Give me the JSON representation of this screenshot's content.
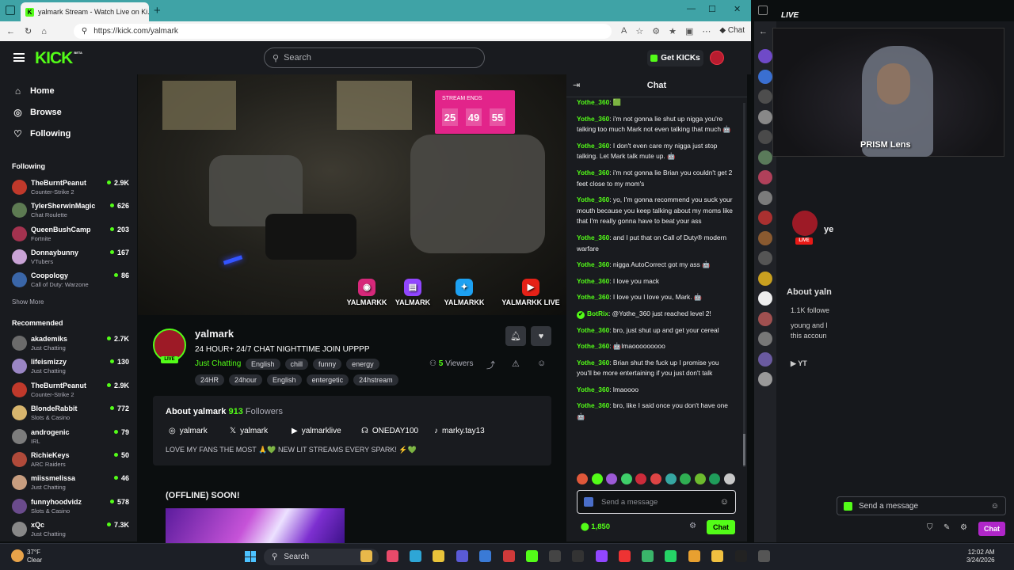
{
  "browser": {
    "tab_title": "yalmark Stream - Watch Live on Ki...",
    "url": "https://kick.com/yalmark",
    "copilot_label": "Chat"
  },
  "header": {
    "logo": "KICK",
    "logo_badge": "BETA",
    "search_placeholder": "Search",
    "get_kicks": "Get KICKs"
  },
  "sidebar": {
    "nav": [
      {
        "label": "Home",
        "icon": "home-icon"
      },
      {
        "label": "Browse",
        "icon": "compass-icon"
      },
      {
        "label": "Following",
        "icon": "heart-icon"
      }
    ],
    "following_title": "Following",
    "following": [
      {
        "name": "TheBurntPeanut",
        "category": "Counter-Strike 2",
        "viewers": "2.9K",
        "color": "#c0392b"
      },
      {
        "name": "TylerSherwinMagic",
        "category": "Chat Roulette",
        "viewers": "626",
        "color": "#5d7a52"
      },
      {
        "name": "QueenBushCamp",
        "category": "Fortnite",
        "viewers": "203",
        "color": "#a3324f"
      },
      {
        "name": "Donnaybunny",
        "category": "VTubers",
        "viewers": "167",
        "color": "#c9a3d6"
      },
      {
        "name": "Coopology",
        "category": "Call of Duty: Warzone",
        "viewers": "86",
        "color": "#3a66a8"
      }
    ],
    "show_more": "Show More",
    "recommended_title": "Recommended",
    "recommended": [
      {
        "name": "akademiks",
        "category": "Just Chatting",
        "viewers": "2.7K",
        "color": "#6b6b6b"
      },
      {
        "name": "lifeismizzy",
        "category": "Just Chatting",
        "viewers": "130",
        "color": "#9a86c4"
      },
      {
        "name": "TheBurntPeanut",
        "category": "Counter-Strike 2",
        "viewers": "2.9K",
        "color": "#c0392b"
      },
      {
        "name": "BlondeRabbit",
        "category": "Slots & Casino",
        "viewers": "772",
        "color": "#d7b56d"
      },
      {
        "name": "androgenic",
        "category": "IRL",
        "viewers": "79",
        "color": "#7c7c7c"
      },
      {
        "name": "RichieKeys",
        "category": "ARC Raiders",
        "viewers": "50",
        "color": "#b04a3a"
      },
      {
        "name": "miissmelissa",
        "category": "Just Chatting",
        "viewers": "46",
        "color": "#c79d7f"
      },
      {
        "name": "funnyhoodvidz",
        "category": "Slots & Casino",
        "viewers": "578",
        "color": "#6a4b8c"
      },
      {
        "name": "xQc",
        "category": "Just Chatting",
        "viewers": "7.3K",
        "color": "#888888"
      }
    ]
  },
  "overlay": {
    "stream_ends": "STREAM ENDS",
    "timer": [
      "25",
      "49",
      "55"
    ],
    "socials": [
      {
        "label": "YALMARKK",
        "icon": "instagram-icon",
        "color": "#d6287a"
      },
      {
        "label": "YALMARK",
        "icon": "twitch-icon",
        "color": "#9146ff"
      },
      {
        "label": "YALMARKK",
        "icon": "twitter-icon",
        "color": "#1da1f2"
      },
      {
        "label": "YALMARKK LIVE",
        "icon": "youtube-icon",
        "color": "#e62117"
      }
    ]
  },
  "channel": {
    "name": "yalmark",
    "live": "LIVE",
    "title": "24 HOUR+ 24/7 CHAT NIGHTTIME JOIN UPPPP",
    "category": "Just Chatting",
    "tags_row1": [
      "English",
      "chill",
      "funny",
      "energy"
    ],
    "tags_row2": [
      "24HR",
      "24hour",
      "English",
      "entergetic",
      "24hstream"
    ],
    "viewers_count": "5",
    "viewers_word": "Viewers"
  },
  "about": {
    "title": "About yalmark",
    "followers_count": "913",
    "followers_word": "Followers",
    "links": [
      {
        "label": "yalmark",
        "icon": "instagram-icon"
      },
      {
        "label": "yalmark",
        "icon": "x-icon"
      },
      {
        "label": "yalmarklive",
        "icon": "youtube-icon"
      },
      {
        "label": "ONEDAY100",
        "icon": "discord-icon"
      },
      {
        "label": "marky.tay13",
        "icon": "tiktok-icon"
      }
    ],
    "bio": "LOVE MY FANS THE MOST 🙏💚 NEW LIT STREAMS EVERY SPARK! ⚡💚",
    "offline_title": "(OFFLINE) SOON!"
  },
  "chat": {
    "title": "Chat",
    "messages": [
      {
        "user": "Yothe_360",
        "text": " 🟩",
        "bot": false
      },
      {
        "user": "Yothe_360",
        "text": " i'm not gonna lie shut up nigga you're talking too much Mark not even talking that much 🤖",
        "bot": false
      },
      {
        "user": "Yothe_360",
        "text": " I don't even care my nigga just stop talking. Let Mark talk mute up. 🤖",
        "bot": false
      },
      {
        "user": "Yothe_360",
        "text": " i'm not gonna lie Brian you couldn't get 2 feet close to my mom's",
        "bot": false
      },
      {
        "user": "Yothe_360",
        "text": " yo, I'm gonna recommend you suck your mouth because you keep talking about my moms like that I'm really gonna have to beat your ass",
        "bot": false
      },
      {
        "user": "Yothe_360",
        "text": " and I put that on Call of Duty® modern warfare",
        "bot": false
      },
      {
        "user": "Yothe_360",
        "text": " nigga AutoCorrect got my ass 🤖",
        "bot": false
      },
      {
        "user": "Yothe_360",
        "text": " I love you mack",
        "bot": false
      },
      {
        "user": "Yothe_360",
        "text": " I love you I love you, Mark. 🤖",
        "bot": false
      },
      {
        "user": "BotRix",
        "text": " @Yothe_360 just reached level 2!",
        "bot": true
      },
      {
        "user": "Yothe_360",
        "text": " bro, just shut up and get your cereal",
        "bot": false
      },
      {
        "user": "Yothe_360",
        "text": " 🤖lmaooooooooo",
        "bot": false
      },
      {
        "user": "Yothe_360",
        "text": " Brian shut the fuck up I promise you you'll be more entertaining if you just don't talk",
        "bot": false
      },
      {
        "user": "Yothe_360",
        "text": " lmaoooo",
        "bot": false
      },
      {
        "user": "Yothe_360",
        "text": " bro, like I said once you don't have one 🤖",
        "bot": false
      }
    ],
    "emote_colors": [
      "#e0583a",
      "#53fc18",
      "#9c5ad6",
      "#3fcf6a",
      "#cc2b3a",
      "#d44",
      "#36a7a2",
      "#2fae52",
      "#6dbb2e",
      "#1f9c5a",
      "#c8c8c8"
    ],
    "send_placeholder": "Send a message",
    "points": "1,850",
    "chat_button": "Chat"
  },
  "obs": {
    "live_label": "LIVE",
    "prism_label": "PRISM Lens",
    "channel_initial": "ye",
    "about_label": "About yaln",
    "followers_label": "1.1K followe",
    "bio_fragment": "young and l",
    "bio_fragment2": "this accoun",
    "yt_label": "YT",
    "send_placeholder": "Send a message",
    "chat_button": "Chat"
  },
  "taskbar": {
    "temp": "37°F",
    "weather": "Clear",
    "search": "Search",
    "time": "12:02 AM",
    "date": "3/24/2026"
  }
}
